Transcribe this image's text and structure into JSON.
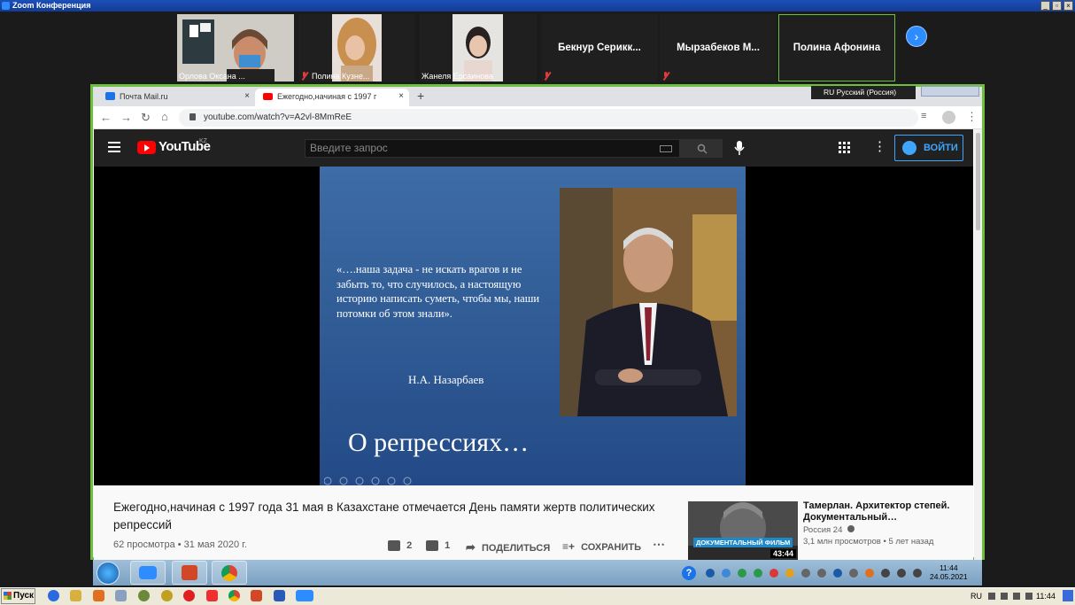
{
  "zoom": {
    "window_title": "Zoom Конференция",
    "participants": [
      {
        "name": "Орлова Оксана ...",
        "muted": false,
        "video": true
      },
      {
        "name": "Полина Кузне...",
        "muted": true,
        "video": true
      },
      {
        "name": "Жанеля Ерсаинова",
        "muted": false,
        "video": true
      },
      {
        "name": "Бекнур Серикк...",
        "muted": true,
        "video": false
      },
      {
        "name": "Мырзабеков М...",
        "muted": true,
        "video": false
      },
      {
        "name": "Полина Афонина",
        "muted": false,
        "video": false,
        "active_speaker": true
      }
    ]
  },
  "browser": {
    "tabs": [
      {
        "label": "Почта Mail.ru",
        "icon": "mail-icon",
        "active": false
      },
      {
        "label": "Ежегодно,начиная с 1997 г",
        "icon": "youtube-icon",
        "active": true
      }
    ],
    "language_indicator": "RU Русский (Россия)",
    "url": "youtube.com/watch?v=A2vl-8MmReE"
  },
  "youtube": {
    "logo": "YouTube",
    "region": "KZ",
    "search_placeholder": "Введите запрос",
    "login_label": "ВОЙТИ",
    "slide": {
      "quote": "«….наша задача - не искать врагов и не забыть то, что случилось, а настоящую историю написать суметь, чтобы мы,  наши потомки об этом знали».",
      "author": "Н.А. Назарбаев",
      "title": "О репрессиях…"
    },
    "video_title": "Ежегодно,начиная с 1997 года 31 мая в Казахстане отмечается День памяти жертв политических репрессий",
    "video_meta": "62 просмотра • 31 мая 2020 г.",
    "likes": "2",
    "dislikes": "1",
    "share_label": "ПОДЕЛИТЬСЯ",
    "save_label": "СОХРАНИТЬ",
    "recommendation": {
      "title": "Тамерлан. Архитектор степей. Документальный…",
      "channel": "Россия 24",
      "stats": "3,1 млн просмотров • 5 лет назад",
      "duration": "43:44",
      "badge": "ДОКУМЕНТАЛЬНЫЙ ФИЛЬМ"
    }
  },
  "win7": {
    "clock_time": "11:44",
    "clock_date": "24.05.2021"
  },
  "xp": {
    "start_label": "Пуск",
    "language": "RU",
    "clock": "11:44"
  },
  "colors": {
    "zoom_blue": "#2d8cff",
    "share_border": "#6fbf3f",
    "yt_red": "#ff0000",
    "yt_blue": "#3ea6ff"
  }
}
